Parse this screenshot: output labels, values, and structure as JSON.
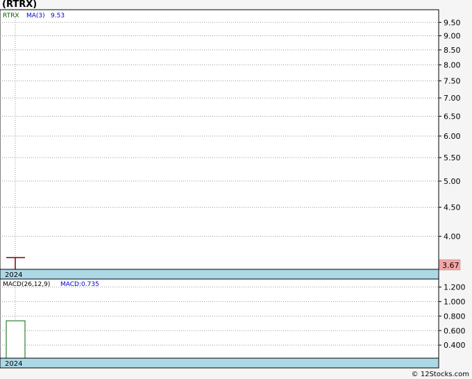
{
  "title": "(RTRX)",
  "credit": "© 12Stocks.com",
  "chart_data": [
    {
      "type": "line",
      "panel": "price",
      "legend": {
        "symbol": "RTRX",
        "ma_label": "MA(3)",
        "ma_value": "9.53"
      },
      "y_ticks": [
        "9.50",
        "9.00",
        "8.50",
        "8.00",
        "7.50",
        "7.00",
        "6.50",
        "6.00",
        "5.50",
        "5.00",
        "4.50",
        "4.00"
      ],
      "y_tick_values": [
        9.5,
        9.0,
        8.5,
        8.0,
        7.5,
        7.0,
        6.5,
        6.0,
        5.5,
        5.0,
        4.5,
        4.0
      ],
      "ylim": [
        3.5,
        10.0
      ],
      "log_scale": true,
      "grid": true,
      "x_label": "2024",
      "price_bar": {
        "open": 3.67,
        "high": 3.67,
        "low": 3.45,
        "close": 3.67
      },
      "last_price_label": "3.67",
      "colors": {
        "symbol": "#006400",
        "ma": "#0000cc",
        "bar": "#800000",
        "last_price_bg": "#f4a6a6",
        "axis_band": "#add8e6"
      }
    },
    {
      "type": "bar",
      "panel": "macd",
      "legend": {
        "label": "MACD(26,12,9)",
        "value_label": "MACD:0.735"
      },
      "y_ticks": [
        "1.200",
        "1.000",
        "0.800",
        "0.600",
        "0.400"
      ],
      "y_tick_values": [
        1.2,
        1.0,
        0.8,
        0.6,
        0.4
      ],
      "ylim": [
        0.22,
        1.31
      ],
      "grid": true,
      "x_label": "2024",
      "values": [
        0.735
      ]
    }
  ]
}
